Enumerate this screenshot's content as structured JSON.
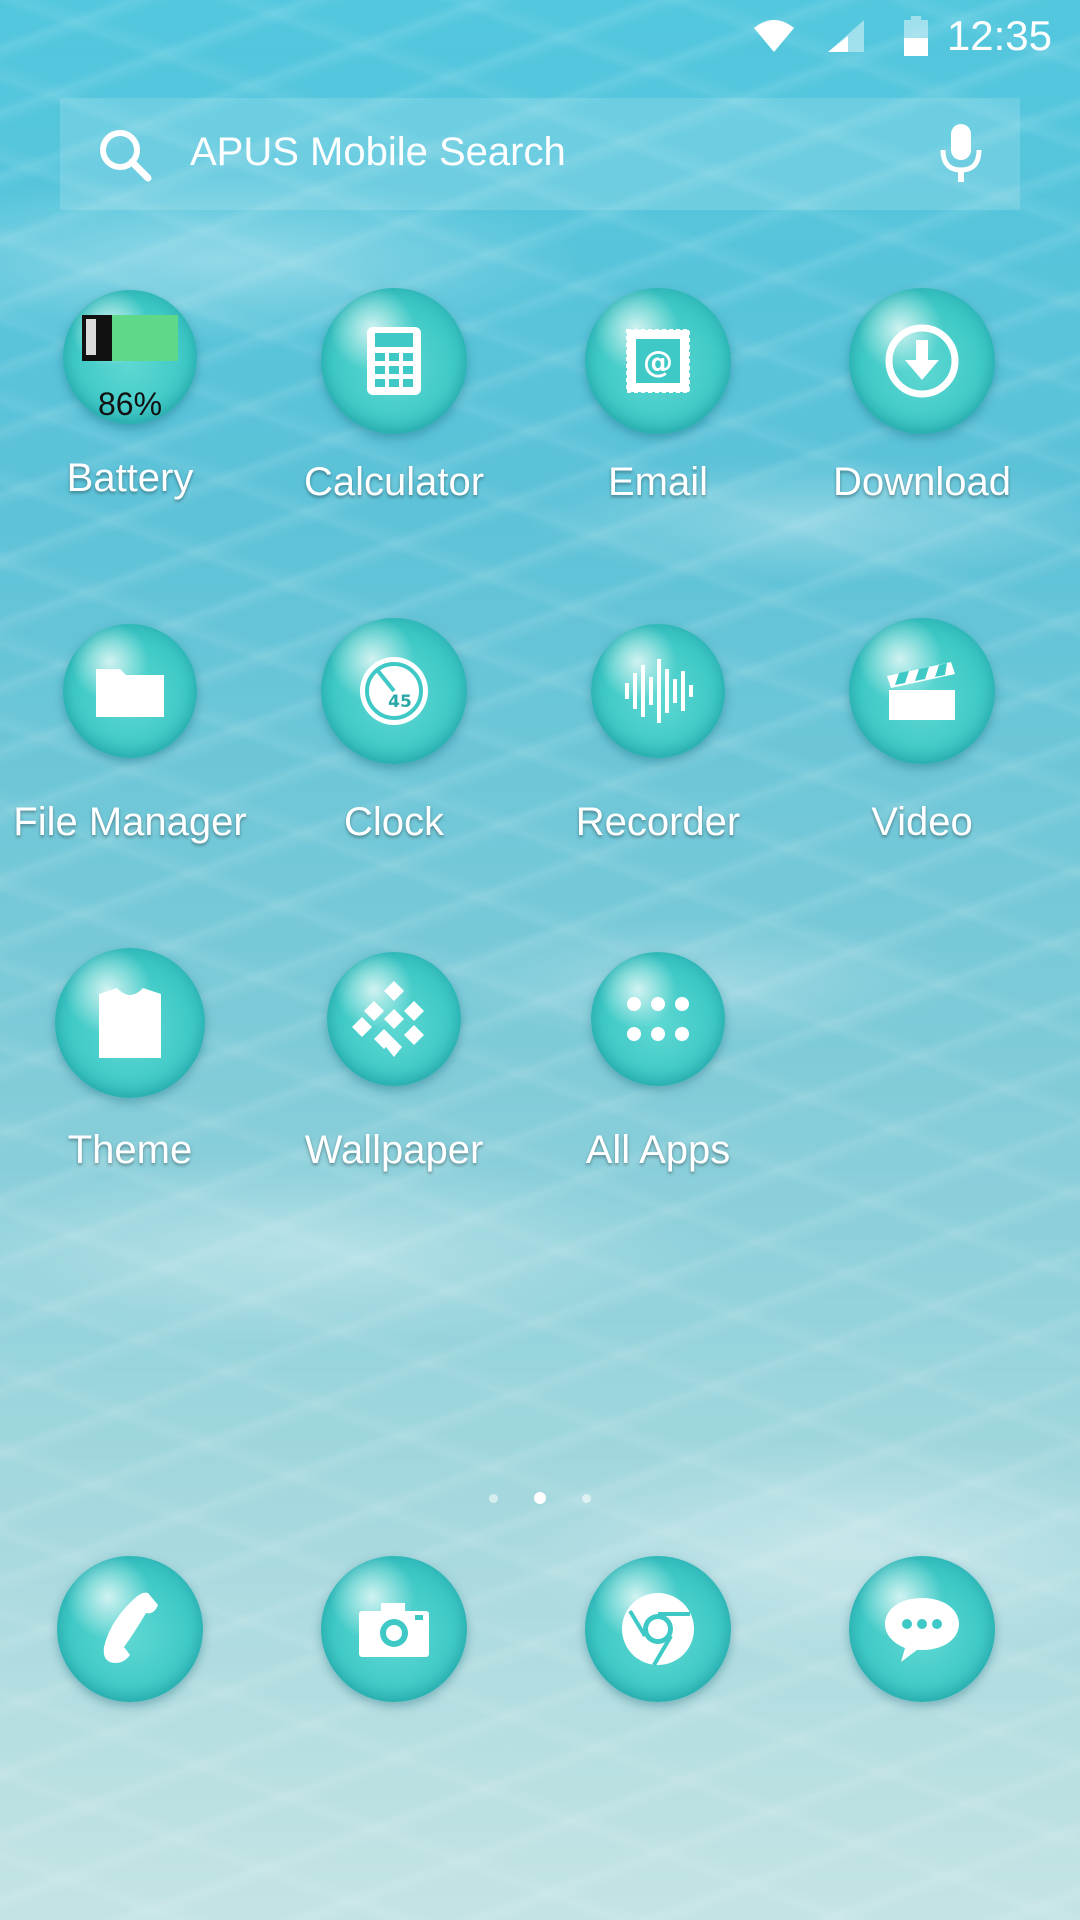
{
  "status_bar": {
    "time": "12:35",
    "icons": [
      "wifi-icon",
      "signal-icon",
      "battery-icon"
    ]
  },
  "search": {
    "placeholder": "APUS Mobile Search",
    "left_icon": "search-icon",
    "right_icon": "microphone-icon"
  },
  "apps": [
    {
      "label": "Battery",
      "icon": "battery-icon",
      "battery_percent": "86%"
    },
    {
      "label": "Calculator",
      "icon": "calculator-icon"
    },
    {
      "label": "Email",
      "icon": "email-icon"
    },
    {
      "label": "Download",
      "icon": "download-icon"
    },
    {
      "label": "File Manager",
      "icon": "folder-icon"
    },
    {
      "label": "Clock",
      "icon": "clock-icon",
      "clock_value": "45"
    },
    {
      "label": "Recorder",
      "icon": "sound-wave-icon"
    },
    {
      "label": "Video",
      "icon": "clapperboard-icon"
    },
    {
      "label": "Theme",
      "icon": "shirt-icon"
    },
    {
      "label": "Wallpaper",
      "icon": "diamond-pattern-icon"
    },
    {
      "label": "All Apps",
      "icon": "grid-dots-icon"
    }
  ],
  "page_indicator": {
    "count": 3,
    "active_index": 1
  },
  "dock": [
    {
      "icon": "phone-icon"
    },
    {
      "icon": "camera-icon"
    },
    {
      "icon": "browser-icon"
    },
    {
      "icon": "messaging-icon"
    }
  ],
  "colors": {
    "bubble": "#3fc9c6",
    "battery_fill": "#5fd88a",
    "water_top": "#52c7de",
    "water_bottom": "#c4e4e4"
  }
}
